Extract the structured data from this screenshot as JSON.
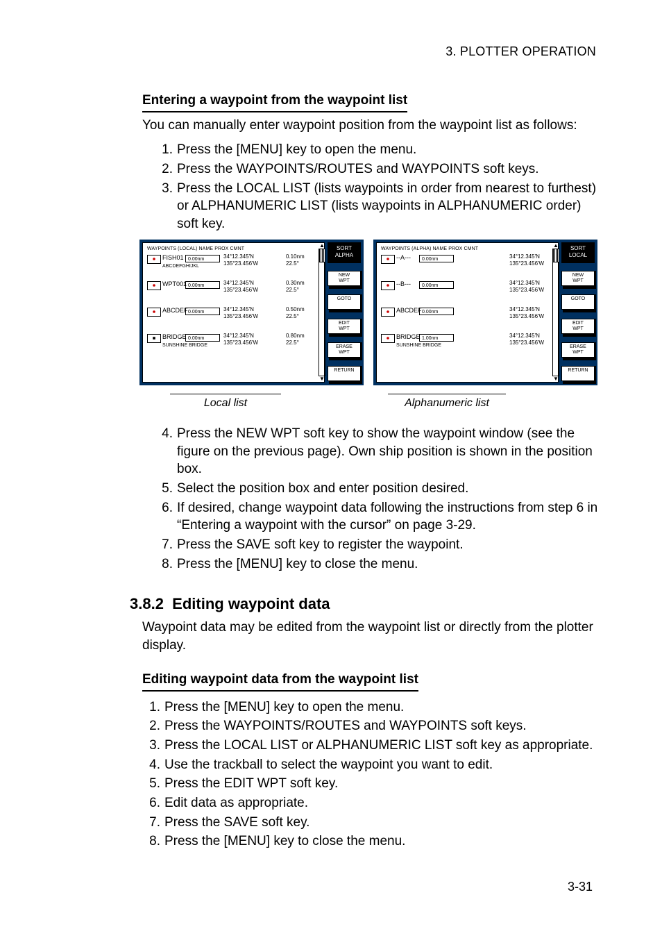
{
  "header": {
    "running": "3. PLOTTER OPERATION",
    "page_number": "3-31"
  },
  "section1": {
    "title": "Entering a waypoint from the waypoint list",
    "intro": "You can manually enter waypoint position from the waypoint list as follows:",
    "steps_a": [
      "Press the [MENU] key to open the menu.",
      "Press the WAYPOINTS/ROUTES and WAYPOINTS soft keys.",
      "Press the LOCAL LIST (lists waypoints in order from nearest to furthest) or ALPHANUMERIC LIST (lists waypoints in ALPHANUMERIC order) soft key."
    ],
    "steps_b": [
      "Press the NEW WPT soft key to show the waypoint window (see the figure on the previous page). Own ship position is shown in the position box.",
      "Select the position box and enter position desired.",
      "If desired, change waypoint data following the instructions from step 6 in “Entering a waypoint with the cursor” on page 3-29.",
      "Press the SAVE soft key to register the waypoint.",
      "Press the [MENU] key to close the menu."
    ]
  },
  "figure": {
    "caption_left": "Local list",
    "caption_right": "Alphanumeric list",
    "local": {
      "subtitle": "WAYPOINTS (LOCAL)    NAME    PROX CMNT",
      "rows": [
        {
          "name": "FISH01",
          "prox": "0.00nm",
          "comment": "ABCDEFGHIJKL",
          "lat": "34°12.345'N",
          "lon": "135°23.456'W",
          "dist": "0.10nm",
          "brg": "22.5°"
        },
        {
          "name": "WPT001",
          "prox": "0.00nm",
          "comment": "",
          "lat": "34°12.345'N",
          "lon": "135°23.456'W",
          "dist": "0.30nm",
          "brg": "22.5°"
        },
        {
          "name": "ABCDEF",
          "prox": "0.00nm",
          "comment": "",
          "lat": "34°12.345'N",
          "lon": "135°23.456'W",
          "dist": "0.50nm",
          "brg": "22.5°"
        },
        {
          "name": "BRIDGE",
          "prox": "0.00nm",
          "comment": "SUNSHINE BRIDGE",
          "lat": "34°12.345'N",
          "lon": "135°23.456'W",
          "dist": "0.80nm",
          "brg": "22.5°",
          "square": true
        }
      ],
      "softkeys": {
        "hard": "SORT\nALPHA",
        "b1": "NEW\nWPT",
        "b2": "GOTO",
        "b3": "EDIT\nWPT",
        "b4": "ERASE\nWPT",
        "b5": "RETURN"
      }
    },
    "alpha": {
      "subtitle": "WAYPOINTS (ALPHA)    NAME    PROX CMNT",
      "rows": [
        {
          "name": "--A---",
          "prox": "0.00nm",
          "comment": "",
          "lat": "34°12.345'N",
          "lon": "135°23.456'W"
        },
        {
          "name": "--B---",
          "prox": "0.00nm",
          "comment": "",
          "lat": "34°12.345'N",
          "lon": "135°23.456'W"
        },
        {
          "name": "ABCDEF",
          "prox": "0.00nm",
          "comment": "",
          "lat": "34°12.345'N",
          "lon": "135°23.456'W"
        },
        {
          "name": "BRIDGE",
          "prox": "1.00nm",
          "comment": "SUNSHINE BRIDGE",
          "lat": "34°12.345'N",
          "lon": "135°23.456'W"
        }
      ],
      "softkeys": {
        "hard": "SORT\nLOCAL",
        "b1": "NEW\nWPT",
        "b2": "GOTO",
        "b3": "EDIT\nWPT",
        "b4": "ERASE\nWPT",
        "b5": "RETURN"
      }
    }
  },
  "section2": {
    "heading_num": "3.8.2",
    "heading": "Editing waypoint data",
    "intro": "Waypoint data may be edited from the waypoint list or directly from the plotter display.",
    "sub_title": "Editing waypoint data from the waypoint list",
    "steps": [
      "Press the [MENU] key to open the menu.",
      "Press the WAYPOINTS/ROUTES and WAYPOINTS soft keys.",
      "Press the LOCAL LIST or ALPHANUMERIC LIST soft key as appropriate.",
      "Use the trackball to select the waypoint you want to edit.",
      "Press the EDIT WPT soft key.",
      "Edit data as appropriate.",
      "Press the SAVE soft key.",
      "Press the [MENU] key to close the menu."
    ]
  }
}
